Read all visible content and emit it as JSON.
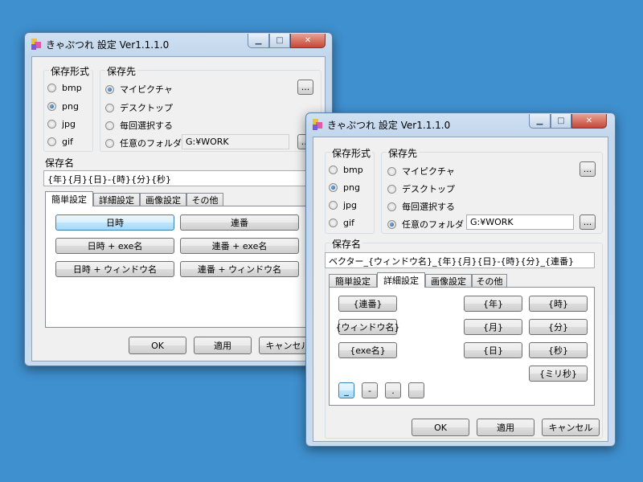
{
  "window_a": {
    "title": "きゃぷつれ 設定 Ver1.1.1.0",
    "controls": {
      "minimize": "▁",
      "maximize": "□",
      "close": "✕"
    },
    "format": {
      "label": "保存形式",
      "options": [
        {
          "label": "bmp",
          "checked": false
        },
        {
          "label": "png",
          "checked": true
        },
        {
          "label": "jpg",
          "checked": false
        },
        {
          "label": "gif",
          "checked": false
        }
      ]
    },
    "dest": {
      "label": "保存先",
      "options": [
        {
          "label": "マイピクチャ",
          "checked": true
        },
        {
          "label": "デスクトップ",
          "checked": false
        },
        {
          "label": "毎回選択する",
          "checked": false
        },
        {
          "label": "任意のフォルダ",
          "checked": false
        }
      ],
      "folder_value": "G:¥WORK",
      "browse_label": "...",
      "browse2_label": "..."
    },
    "name": {
      "label": "保存名",
      "value": "{年}{月}{日}-{時}{分}{秒}"
    },
    "tabs": [
      "簡単設定",
      "詳細設定",
      "画像設定",
      "その他"
    ],
    "buttons": {
      "b1": "日時",
      "b2": "連番",
      "b3": "日時 + exe名",
      "b4": "連番 + exe名",
      "b5": "日時 + ウィンドウ名",
      "b6": "連番 + ウィンドウ名"
    },
    "footer": {
      "ok": "OK",
      "apply": "適用",
      "cancel": "キャンセル"
    }
  },
  "window_b": {
    "title": "きゃぷつれ 設定 Ver1.1.1.0",
    "controls": {
      "minimize": "▁",
      "maximize": "□",
      "close": "✕"
    },
    "format": {
      "label": "保存形式",
      "options": [
        {
          "label": "bmp",
          "checked": false
        },
        {
          "label": "png",
          "checked": true
        },
        {
          "label": "jpg",
          "checked": false
        },
        {
          "label": "gif",
          "checked": false
        }
      ]
    },
    "dest": {
      "label": "保存先",
      "options": [
        {
          "label": "マイピクチャ",
          "checked": false
        },
        {
          "label": "デスクトップ",
          "checked": false
        },
        {
          "label": "毎回選択する",
          "checked": false
        },
        {
          "label": "任意のフォルダ",
          "checked": true
        }
      ],
      "folder_value": "G:¥WORK",
      "browse_label": "...",
      "browse2_label": "..."
    },
    "name": {
      "label": "保存名",
      "value": "ベクター_{ウィンドウ名}_{年}{月}{日}-{時}{分}_{連番}"
    },
    "tabs": [
      "簡単設定",
      "詳細設定",
      "画像設定",
      "その他"
    ],
    "tokens": {
      "renban": "{連番}",
      "window": "{ウィンドウ名}",
      "exe": "{exe名}",
      "year": "{年}",
      "hour": "{時}",
      "month": "{月}",
      "minute": "{分}",
      "day": "{日}",
      "second": "{秒}",
      "ms": "{ミリ秒}"
    },
    "separators": [
      "_",
      "-",
      ".",
      " "
    ],
    "footer": {
      "ok": "OK",
      "apply": "適用",
      "cancel": "キャンセル"
    }
  }
}
